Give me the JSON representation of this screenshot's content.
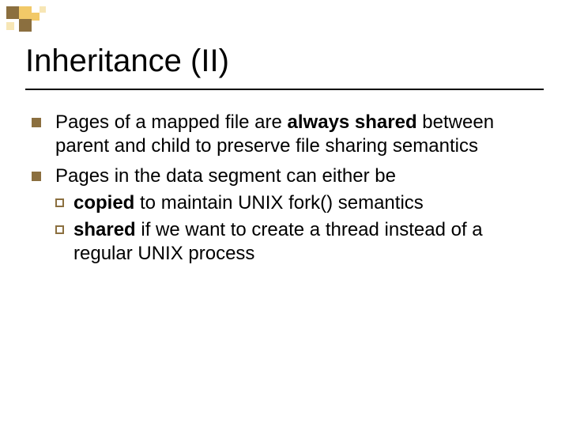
{
  "title": "Inheritance (II)",
  "bullets": [
    {
      "pre": "Pages of a mapped file are ",
      "bold": "always shared",
      "post": " between parent and child to preserve file sharing semantics"
    },
    {
      "text": "Pages in the data segment can either be",
      "sub": [
        {
          "bold": "copied",
          "rest": " to maintain UNIX fork() semantics"
        },
        {
          "bold": "shared",
          "rest": " if we want to create a thread instead of a regular UNIX process"
        }
      ]
    }
  ],
  "deco": {
    "colors": {
      "dark": "#8b6f3f",
      "light": "#f2c968",
      "pale": "#f7e6b5"
    }
  }
}
